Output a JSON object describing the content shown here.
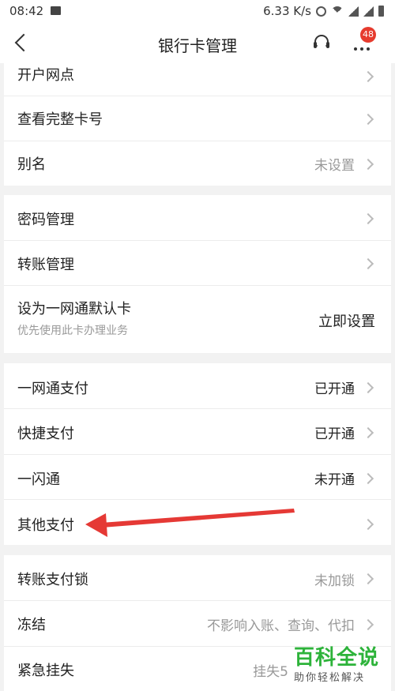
{
  "status_bar": {
    "time": "08:42",
    "speed": "6.33 K/s"
  },
  "nav": {
    "title": "银行卡管理",
    "badge": "48",
    "icons": [
      "back-icon",
      "headset-icon",
      "more-icon"
    ]
  },
  "groups": [
    {
      "rows": [
        {
          "label": "开户网点",
          "value": ""
        },
        {
          "label": "查看完整卡号",
          "value": ""
        },
        {
          "label": "别名",
          "value": "未设置"
        }
      ]
    },
    {
      "rows": [
        {
          "label": "密码管理",
          "value": ""
        },
        {
          "label": "转账管理",
          "value": ""
        },
        {
          "label": "设为一网通默认卡",
          "sub": "优先使用此卡办理业务",
          "value": "立即设置"
        }
      ]
    },
    {
      "rows": [
        {
          "label": "一网通支付",
          "value": "已开通"
        },
        {
          "label": "快捷支付",
          "value": "已开通"
        },
        {
          "label": "一闪通",
          "value": "未开通"
        },
        {
          "label": "其他支付",
          "value": ""
        }
      ]
    },
    {
      "rows": [
        {
          "label": "转账支付锁",
          "value": "未加锁"
        },
        {
          "label": "冻结",
          "value": "不影响入账、查询、代扣"
        },
        {
          "label": "紧急挂失",
          "value": "挂失5"
        }
      ]
    }
  ],
  "annotation": {
    "color": "#e53935"
  },
  "watermark": {
    "title": "百科全说",
    "subtitle": "助你轻松解决"
  }
}
